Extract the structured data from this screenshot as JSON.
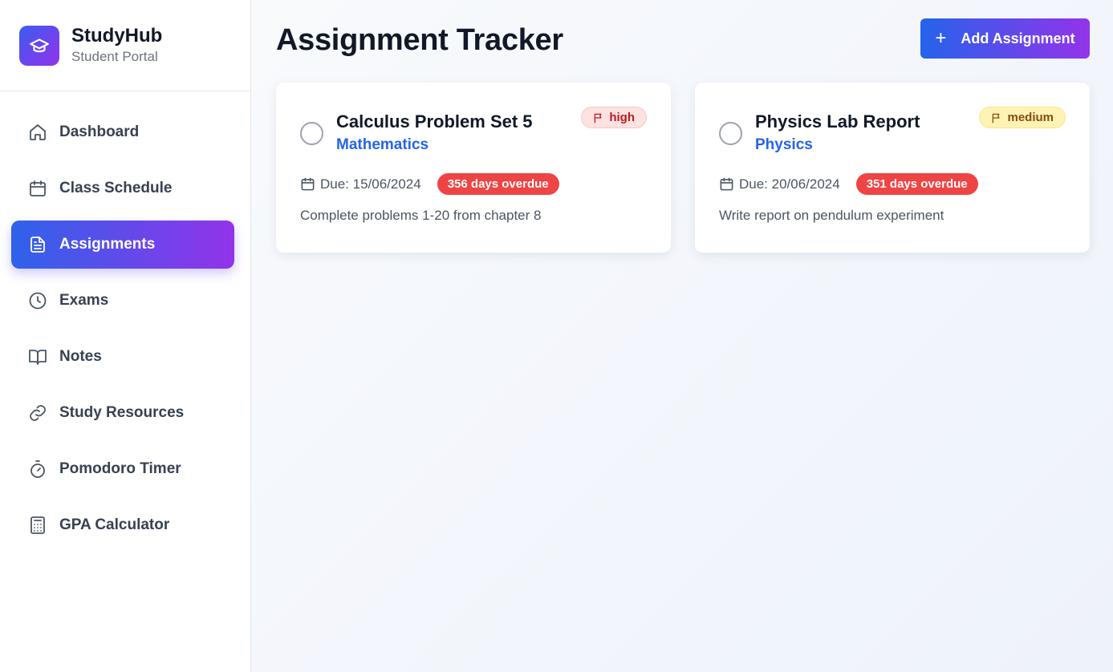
{
  "brand": {
    "name": "StudyHub",
    "subtitle": "Student Portal"
  },
  "sidebar": {
    "items": [
      {
        "label": "Dashboard",
        "icon": "home-icon",
        "active": false
      },
      {
        "label": "Class Schedule",
        "icon": "calendar-icon",
        "active": false
      },
      {
        "label": "Assignments",
        "icon": "document-icon",
        "active": true
      },
      {
        "label": "Exams",
        "icon": "clock-icon",
        "active": false
      },
      {
        "label": "Notes",
        "icon": "book-open-icon",
        "active": false
      },
      {
        "label": "Study Resources",
        "icon": "link-icon",
        "active": false
      },
      {
        "label": "Pomodoro Timer",
        "icon": "timer-icon",
        "active": false
      },
      {
        "label": "GPA Calculator",
        "icon": "calculator-icon",
        "active": false
      }
    ]
  },
  "header": {
    "title": "Assignment Tracker",
    "add_label": "Add Assignment"
  },
  "assignments": [
    {
      "title": "Calculus Problem Set 5",
      "subject": "Mathematics",
      "priority": "high",
      "due": "Due: 15/06/2024",
      "overdue": "356 days overdue",
      "description": "Complete problems 1-20 from chapter 8"
    },
    {
      "title": "Physics Lab Report",
      "subject": "Physics",
      "priority": "medium",
      "due": "Due: 20/06/2024",
      "overdue": "351 days overdue",
      "description": "Write report on pendulum experiment"
    }
  ],
  "colors": {
    "accent_start": "#2563eb",
    "accent_end": "#9333ea",
    "overdue": "#ef4444",
    "high_bg": "#fde2e2",
    "medium_bg": "#fef3b5"
  }
}
